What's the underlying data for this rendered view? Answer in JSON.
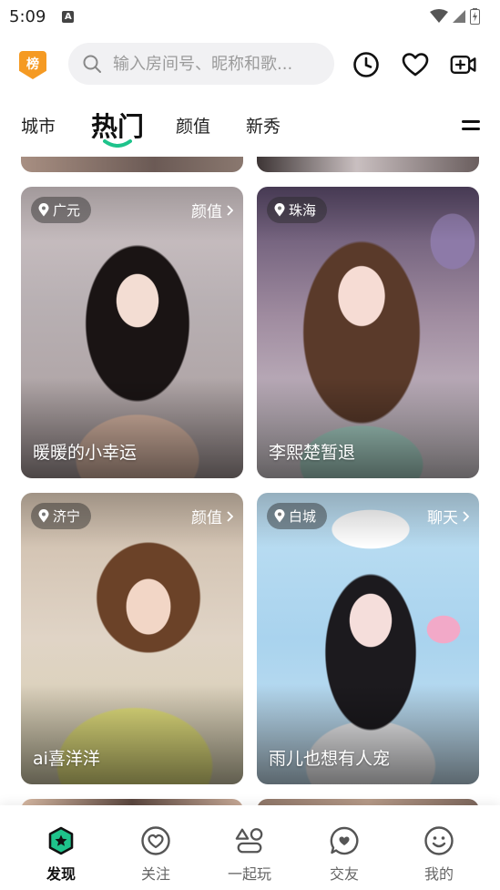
{
  "status_bar": {
    "time": "5:09",
    "notification_letter": "A"
  },
  "header": {
    "rank_badge": "榜",
    "search_placeholder": "输入房间号、昵称和歌..."
  },
  "tabs": [
    {
      "label": "城市",
      "active": false
    },
    {
      "label": "热门",
      "active": true
    },
    {
      "label": "颜值",
      "active": false
    },
    {
      "label": "新秀",
      "active": false
    }
  ],
  "cards": [
    {
      "location": "广元",
      "category": "颜值",
      "name": "暖暖的小幸运"
    },
    {
      "location": "珠海",
      "category": "",
      "name": "李熙楚暂退"
    },
    {
      "location": "济宁",
      "category": "颜值",
      "name": "ai喜洋洋"
    },
    {
      "location": "白城",
      "category": "聊天",
      "name": "雨儿也想有人宠"
    }
  ],
  "bottom_nav": [
    {
      "label": "发现",
      "icon": "discover-icon",
      "active": true
    },
    {
      "label": "关注",
      "icon": "heart-face-icon",
      "active": false
    },
    {
      "label": "一起玩",
      "icon": "shapes-icon",
      "active": false
    },
    {
      "label": "交友",
      "icon": "chat-bubble-icon",
      "active": false
    },
    {
      "label": "我的",
      "icon": "smiley-icon",
      "active": false
    }
  ],
  "colors": {
    "accent": "#1ec38b",
    "badge": "#f59a23"
  }
}
